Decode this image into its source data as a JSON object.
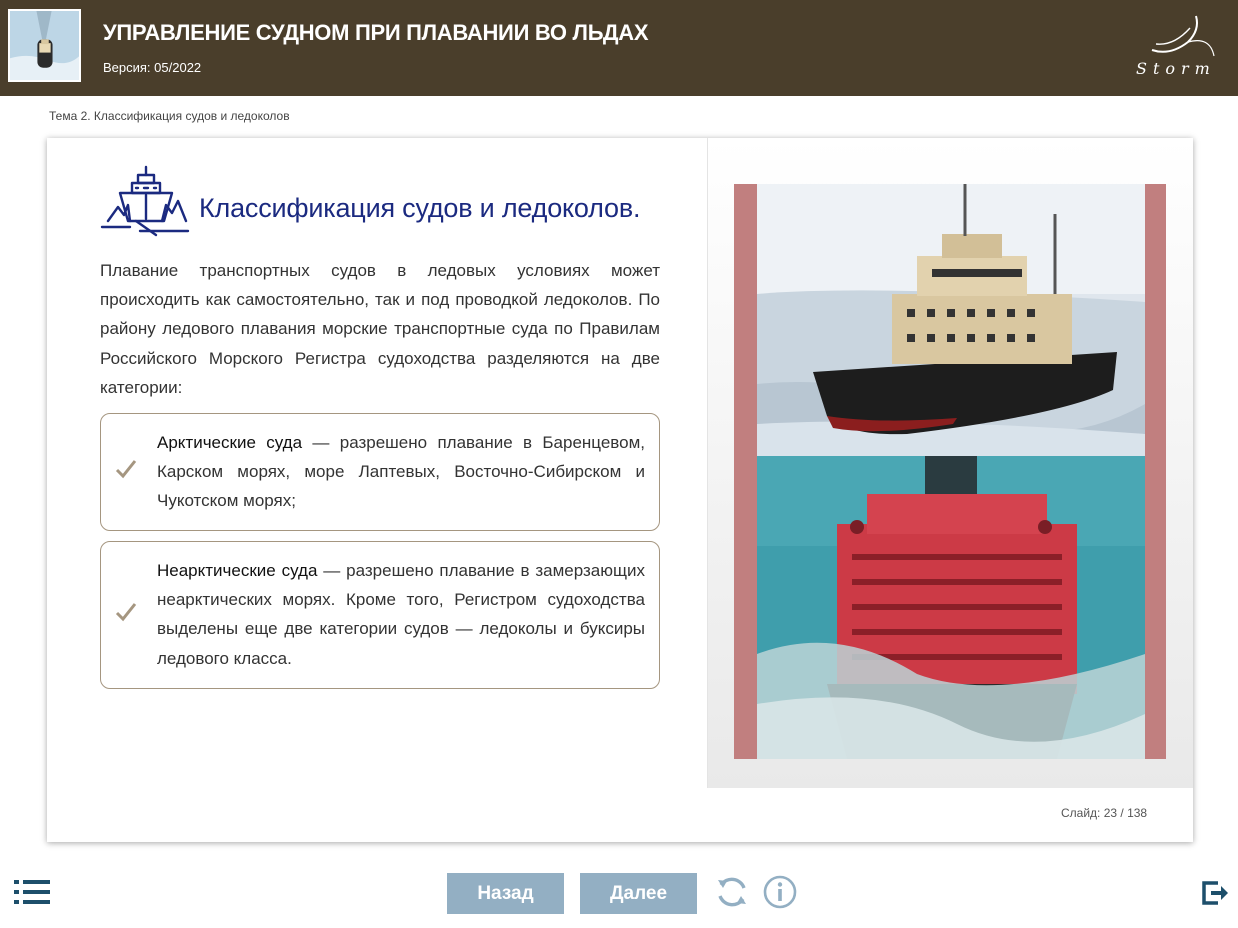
{
  "header": {
    "title": "УПРАВЛЕНИЕ СУДНОМ ПРИ ПЛАВАНИИ ВО ЛЬДАХ",
    "version": "Версия: 05/2022",
    "logo_text": "Storm"
  },
  "breadcrumb": "Тема 2. Классификация судов и ледоколов",
  "slide": {
    "heading": "Классификация судов и ледоколов.",
    "intro": "Плавание транспортных судов в ледовых условиях может происходить как самостоятельно, так и под проводкой ледоколов. По району ледового плавания морские транспортные суда по Правилам Российского Морского Регистра судоходства разделяются на две категории:",
    "items": [
      {
        "term": "Арктические суда",
        "text": " — разрешено плавание в Баренцевом, Карском морях, море Лаптевых, Восточно-Сибирском и Чукотском морях;"
      },
      {
        "term": "Неарктические суда",
        "text": " — разрешено плавание в замерзающих неарктических морях. Кроме того, Регистром судоходства выделены еще две категории судов — ледоколы и буксиры ледового класса."
      }
    ],
    "counter": "Слайд:  23 / 138"
  },
  "footer": {
    "back_label": "Назад",
    "next_label": "Далее"
  },
  "colors": {
    "header_bg": "#4a3e2b",
    "heading": "#1b2a80",
    "nav_button": "#93afc3",
    "footer_icon": "#1d4f6b",
    "photo_frame": "#c17f7f"
  },
  "icons": [
    "icebreaker-thumbnail",
    "storm-logo",
    "icebreaker-heading-icon",
    "checkmark-icon",
    "menu-icon",
    "reload-icon",
    "info-icon",
    "exit-icon"
  ]
}
